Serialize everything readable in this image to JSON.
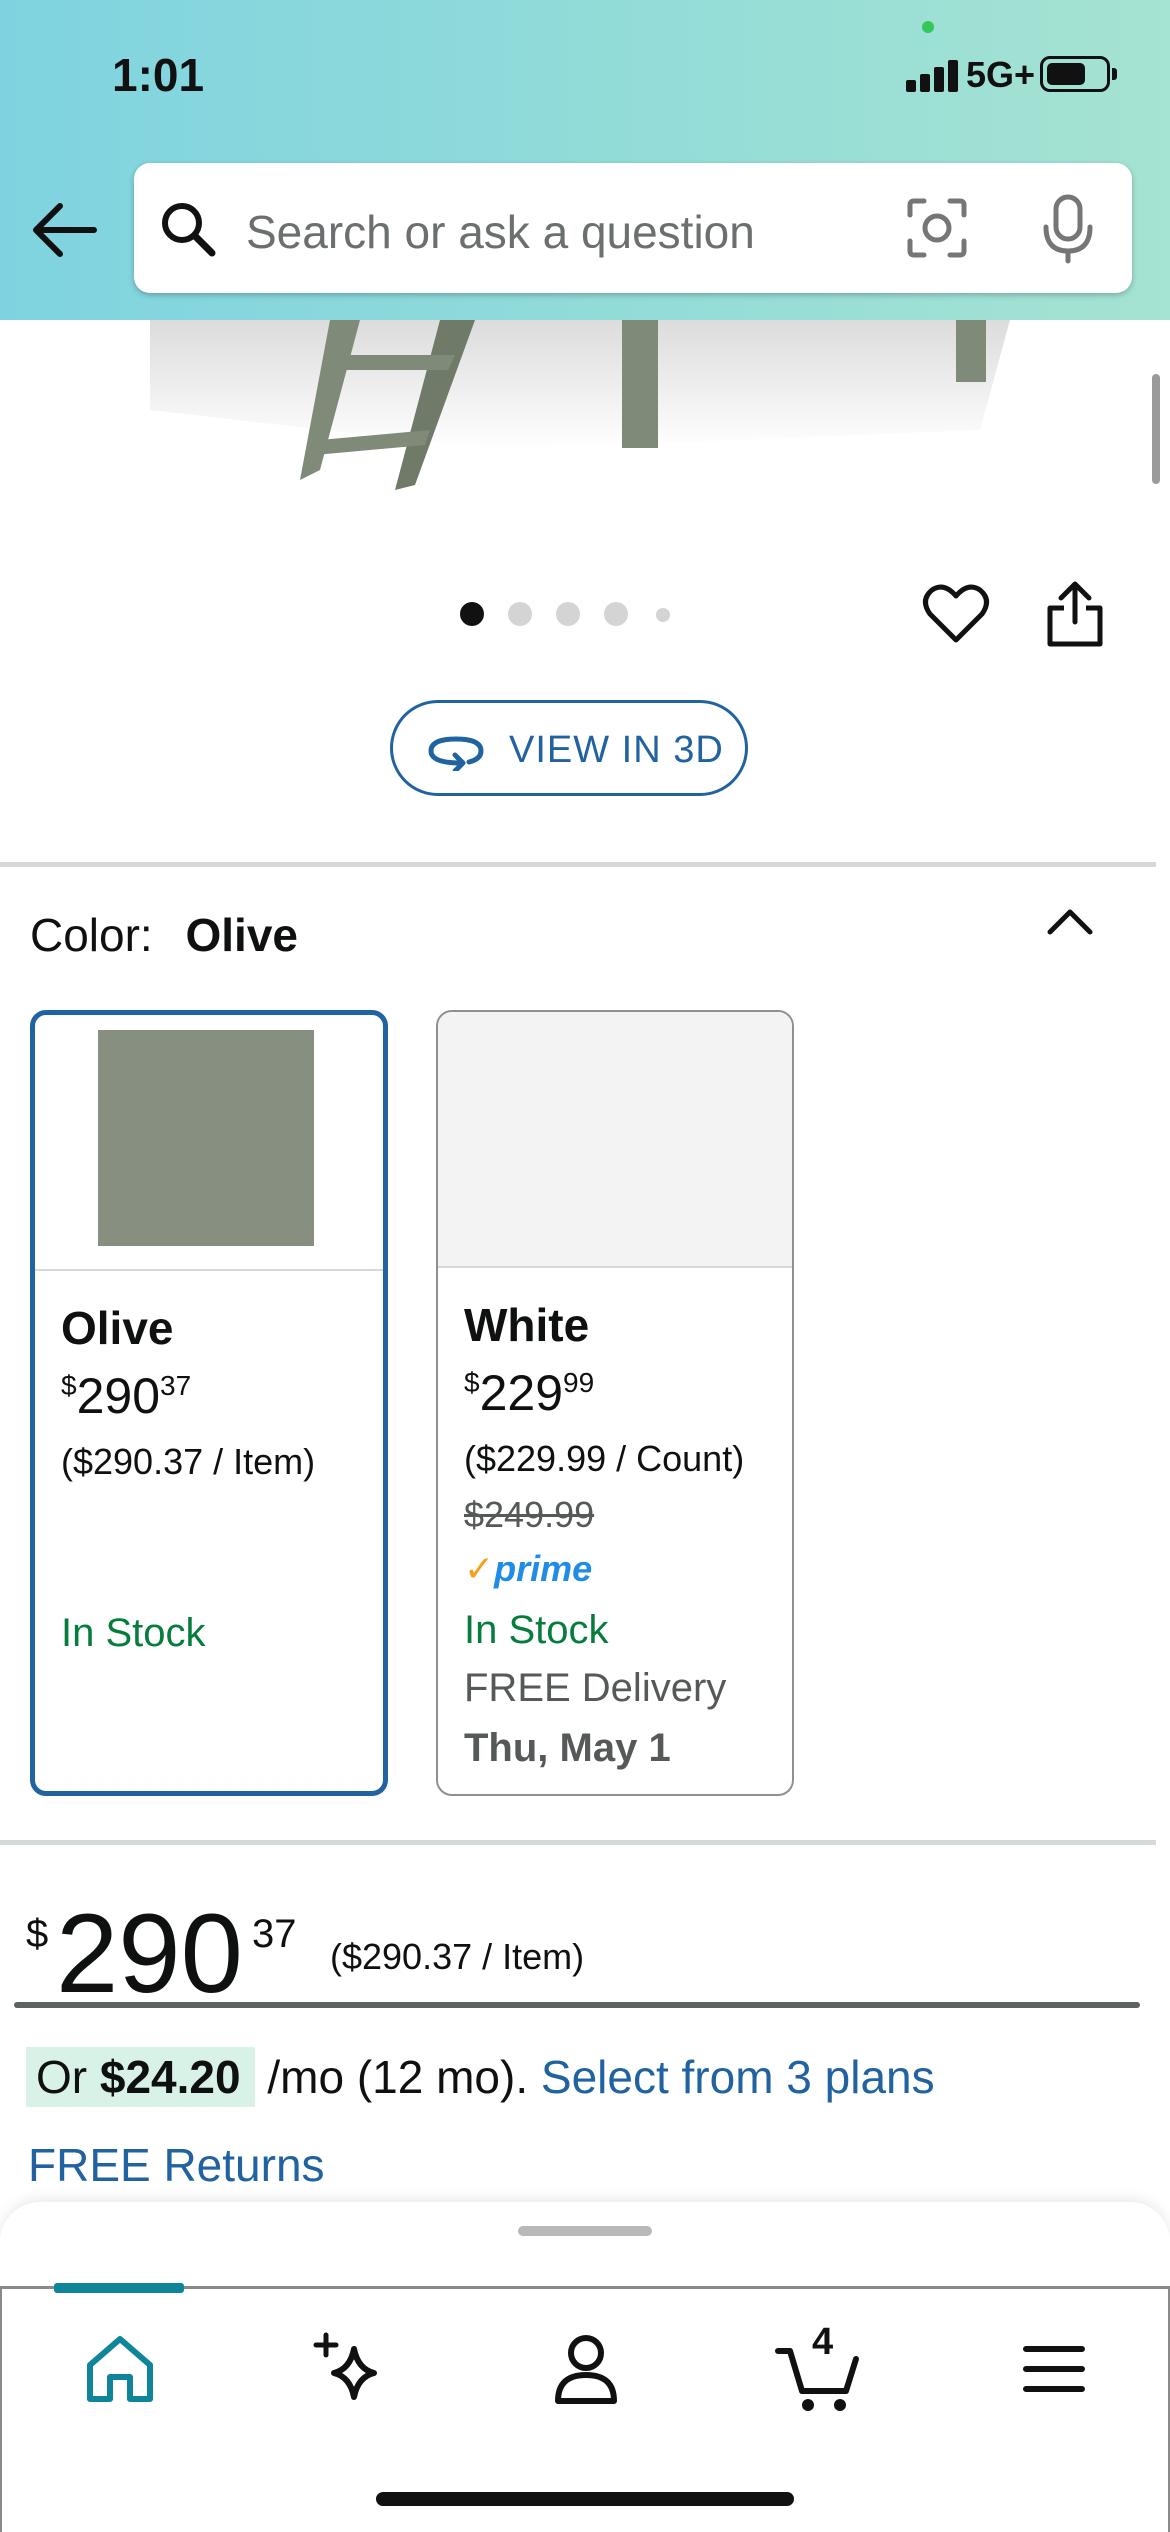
{
  "status_bar": {
    "time": "1:01",
    "network": "5G+"
  },
  "search": {
    "placeholder": "Search or ask a question"
  },
  "gallery": {
    "image_count": 5,
    "active_index": 0
  },
  "view_3d": {
    "label": "VIEW IN 3D"
  },
  "color_selector": {
    "label": "Color:",
    "selected": "Olive",
    "options": [
      {
        "name": "Olive",
        "price_symbol": "$",
        "price_whole": "290",
        "price_fraction": "37",
        "unit_price": "($290.37 / Item)",
        "stock": "In Stock",
        "swatch_color": "#868f80",
        "selected": true
      },
      {
        "name": "White",
        "price_symbol": "$",
        "price_whole": "229",
        "price_fraction": "99",
        "unit_price": "($229.99 / Count)",
        "list_price": "$249.99",
        "prime": "prime",
        "stock": "In Stock",
        "delivery": "FREE Delivery",
        "delivery_date": "Thu, May 1",
        "swatch_color": "#f3f3f3",
        "selected": false
      }
    ]
  },
  "price": {
    "symbol": "$",
    "whole": "290",
    "fraction": "37",
    "unit_price": "($290.37 / Item)"
  },
  "installment": {
    "prefix": "Or",
    "amount": "$24.20",
    "term": "/mo (12 mo).",
    "link": "Select from 3 plans"
  },
  "returns": {
    "label": "FREE Returns"
  },
  "bottom_nav": {
    "items": [
      {
        "name": "home",
        "icon": "home-icon",
        "active": true
      },
      {
        "name": "rufus",
        "icon": "sparkle-icon"
      },
      {
        "name": "account",
        "icon": "person-icon"
      },
      {
        "name": "cart",
        "icon": "cart-icon",
        "count": "4"
      },
      {
        "name": "menu",
        "icon": "menu-icon"
      }
    ]
  },
  "colors": {
    "accent": "#2162a1",
    "in_stock": "#067d3d",
    "nav_active": "#0f8599",
    "header_gradient_start": "#7fd3e0",
    "header_gradient_end": "#a5e3d2"
  }
}
